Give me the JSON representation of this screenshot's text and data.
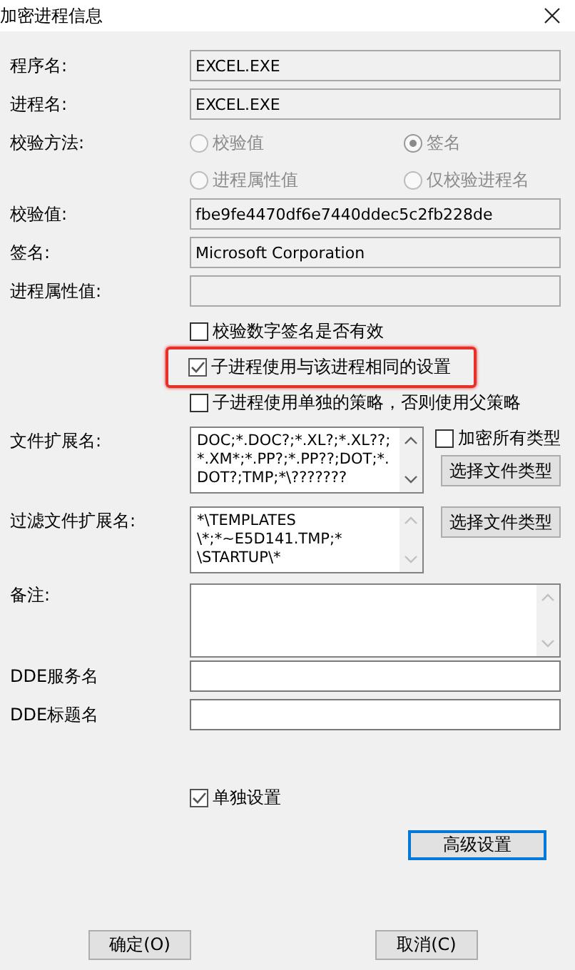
{
  "window": {
    "title": "加密进程信息"
  },
  "rows": [
    {
      "kind": "field",
      "label": "程序名:",
      "value": "EXCEL.EXE",
      "disabled": true
    },
    {
      "kind": "field",
      "label": "进程名:",
      "value": "EXCEL.EXE",
      "disabled": true
    },
    {
      "kind": "radios",
      "label": "校验方法:",
      "disabled": true,
      "options": [
        {
          "label": "校验值",
          "selected": false
        },
        {
          "label": "签名",
          "selected": true
        },
        {
          "label": "进程属性值",
          "selected": false
        },
        {
          "label": "仅校验进程名",
          "selected": false
        }
      ]
    },
    {
      "kind": "field",
      "label": "校验值:",
      "value": "fbe9fe4470df6e7440ddec5c2fb228de",
      "disabled": true
    },
    {
      "kind": "field",
      "label": "签名:",
      "value": "Microsoft Corporation",
      "disabled": true
    },
    {
      "kind": "field",
      "label": "进程属性值:",
      "disabled": true
    },
    {
      "kind": "checkbox",
      "label": "校验数字签名是否有效",
      "checked": false,
      "highlighted": false
    },
    {
      "kind": "checkbox",
      "label": "子进程使用与该进程相同的设置",
      "checked": true,
      "highlighted": true
    },
    {
      "kind": "checkbox",
      "label": "子进程使用单独的策略，否则使用父策略",
      "checked": false,
      "highlighted": false
    },
    {
      "kind": "listbox",
      "label": "文件扩展名:",
      "lines": [
        "DOC;*.DOC?;*.XL?;*.XL??;",
        "*.XM*;*.PP?;*.PP??;DOT;*.",
        "DOT?;TMP;*\\???????"
      ],
      "scroll_enabled": true,
      "option": {
        "label": "加密所有类型",
        "checked": false
      },
      "button": "选择文件类型"
    },
    {
      "kind": "listbox",
      "label": "过滤文件扩展名:",
      "lines": [
        "*\\TEMPLATES",
        "\\*;*~E5D141.TMP;*",
        "\\STARTUP\\*"
      ],
      "scroll_enabled": false,
      "button": "选择文件类型"
    },
    {
      "kind": "memo",
      "label": "备注:",
      "scroll_enabled": false
    },
    {
      "kind": "field",
      "label": "DDE服务名",
      "disabled": false
    },
    {
      "kind": "field",
      "label": "DDE标题名",
      "disabled": false
    },
    {
      "kind": "gap"
    },
    {
      "kind": "checkbox",
      "label": "单独设置",
      "checked": true,
      "highlighted": false
    },
    {
      "kind": "button",
      "label": "高级设置",
      "focused": true
    }
  ],
  "footer": [
    "确定(O)",
    "取消(C)"
  ]
}
